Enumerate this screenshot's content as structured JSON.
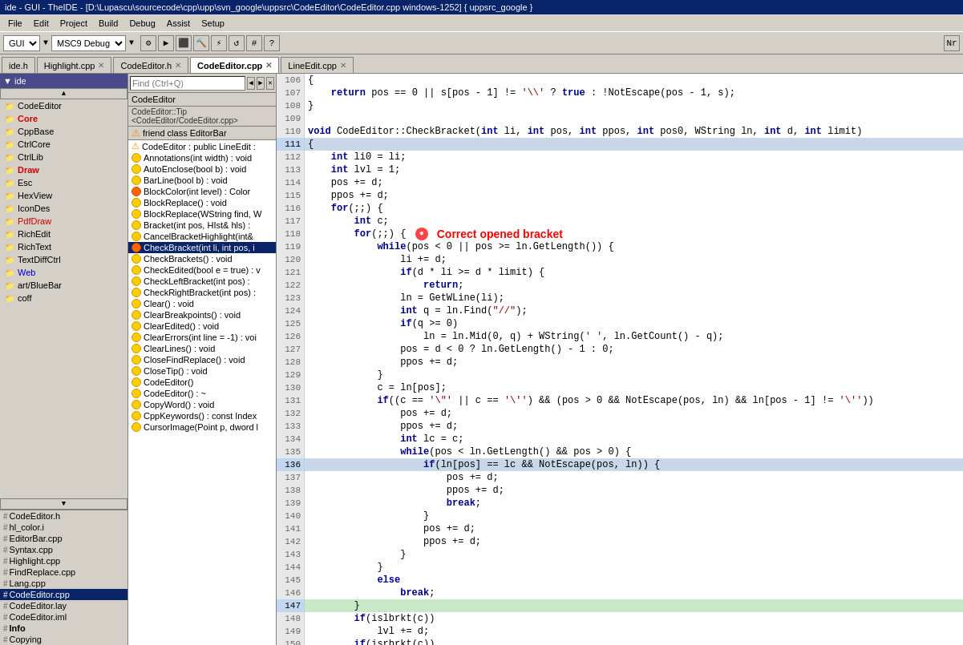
{
  "titleBar": {
    "text": "ide - GUI - TheIDE - [D:\\Lupascu\\sourcecode\\cpp\\upp\\svn_google\\uppsrc\\CodeEditor\\CodeEditor.cpp windows-1252] { uppsrc_google }"
  },
  "menuBar": {
    "items": [
      "File",
      "Edit",
      "Project",
      "Build",
      "Debug",
      "Assist",
      "Setup"
    ]
  },
  "toolbar": {
    "dropdowns": [
      "GUI",
      "MSC9 Debug"
    ]
  },
  "tabs": [
    {
      "label": "ide.h",
      "active": false,
      "closable": false
    },
    {
      "label": "Highlight.cpp",
      "active": false,
      "closable": true
    },
    {
      "label": "CodeEditor.h",
      "active": false,
      "closable": true
    },
    {
      "label": "CodeEditor.cpp",
      "active": true,
      "closable": true
    },
    {
      "label": "LineEdit.cpp",
      "active": false,
      "closable": true
    }
  ],
  "sidebar": {
    "header": "ide",
    "items": [
      {
        "label": "CodeEditor",
        "indent": 0,
        "selected": false
      },
      {
        "label": "Core",
        "indent": 0,
        "selected": false,
        "bold": true,
        "color": "#cc0000"
      },
      {
        "label": "CppBase",
        "indent": 0,
        "selected": false
      },
      {
        "label": "CtrlCore",
        "indent": 0,
        "selected": false
      },
      {
        "label": "CtrlLib",
        "indent": 0,
        "selected": false
      },
      {
        "label": "Draw",
        "indent": 0,
        "selected": false,
        "bold": true,
        "color": "#cc0000"
      },
      {
        "label": "Esc",
        "indent": 0,
        "selected": false
      },
      {
        "label": "HexView",
        "indent": 0,
        "selected": false
      },
      {
        "label": "IconDes",
        "indent": 0,
        "selected": false
      },
      {
        "label": "PdfDraw",
        "indent": 0,
        "selected": false,
        "color": "#cc0000"
      },
      {
        "label": "RichEdit",
        "indent": 0,
        "selected": false
      },
      {
        "label": "RichText",
        "indent": 0,
        "selected": false
      },
      {
        "label": "TextDiffCtrl",
        "indent": 0,
        "selected": false
      },
      {
        "label": "Web",
        "indent": 0,
        "selected": false,
        "color": "#0000cc"
      },
      {
        "label": "art/BlueBar",
        "indent": 0,
        "selected": false
      },
      {
        "label": "coff",
        "indent": 0,
        "selected": false
      }
    ]
  },
  "fileList": {
    "items": [
      {
        "label": "CodeEditor.h",
        "icon": "#"
      },
      {
        "label": "hl_color.i",
        "icon": "#"
      },
      {
        "label": "EditorBar.cpp",
        "icon": "#"
      },
      {
        "label": "Syntax.cpp",
        "icon": "#"
      },
      {
        "label": "Highlight.cpp",
        "icon": "#"
      },
      {
        "label": "FindReplace.cpp",
        "icon": "#"
      },
      {
        "label": "Lang.cpp",
        "icon": "#"
      },
      {
        "label": "CodeEditor.cpp",
        "icon": "#",
        "selected": true
      },
      {
        "label": "CodeEditor.lay",
        "icon": "#"
      },
      {
        "label": "CodeEditor.iml",
        "icon": "#"
      },
      {
        "label": "Info",
        "icon": "#"
      },
      {
        "label": "Copying",
        "icon": "#"
      }
    ]
  },
  "outline": {
    "header": "CodeEditor",
    "subheader": "CodeEditor::Tip",
    "path": "<CodeEditor/CodeEditor.cpp>",
    "listHeader": "friend class EditorBar",
    "items": [
      {
        "label": "CodeEditor : public LineEdit :",
        "type": "warning",
        "dot": null
      },
      {
        "label": "Annotations(int width) : void",
        "type": "dot",
        "dot": "yellow"
      },
      {
        "label": "AutoEnclose(bool b) : void",
        "type": "dot",
        "dot": "yellow"
      },
      {
        "label": "BarLine(bool b) : void",
        "type": "dot",
        "dot": "yellow"
      },
      {
        "label": "BlockColor(int level) : Color",
        "type": "dot",
        "dot": "orange"
      },
      {
        "label": "BlockReplace() : void",
        "type": "dot",
        "dot": "yellow"
      },
      {
        "label": "BlockReplace(WString find, W",
        "type": "dot",
        "dot": "yellow"
      },
      {
        "label": "Bracket(int pos, HIst& hls) :",
        "type": "dot",
        "dot": "yellow"
      },
      {
        "label": "CancelBracketHighlight(int&",
        "type": "dot",
        "dot": "yellow"
      },
      {
        "label": "CheckBracket(int li, int pos, i",
        "type": "dot",
        "dot": "orange",
        "selected": true
      },
      {
        "label": "CheckBrackets() : void",
        "type": "dot",
        "dot": "yellow"
      },
      {
        "label": "CheckEdited(bool e = true) : v",
        "type": "dot",
        "dot": "yellow"
      },
      {
        "label": "CheckLeftBracket(int pos) :",
        "type": "dot",
        "dot": "yellow"
      },
      {
        "label": "CheckRightBracket(int pos) :",
        "type": "dot",
        "dot": "yellow"
      },
      {
        "label": "Clear() : void",
        "type": "dot",
        "dot": "yellow"
      },
      {
        "label": "ClearBreakpoints() : void",
        "type": "dot",
        "dot": "yellow"
      },
      {
        "label": "ClearEdited() : void",
        "type": "dot",
        "dot": "yellow"
      },
      {
        "label": "ClearErrors(int line = -1) : voi",
        "type": "dot",
        "dot": "yellow"
      },
      {
        "label": "ClearLines() : void",
        "type": "dot",
        "dot": "yellow"
      },
      {
        "label": "CloseFindReplace() : void",
        "type": "dot",
        "dot": "yellow"
      },
      {
        "label": "CloseTip() : void",
        "type": "dot",
        "dot": "yellow"
      },
      {
        "label": "CodeEditor()",
        "type": "dot",
        "dot": "yellow"
      },
      {
        "label": "CodeEditor() : ~",
        "type": "dot",
        "dot": "yellow"
      },
      {
        "label": "CopyWord() : void",
        "type": "dot",
        "dot": "yellow"
      },
      {
        "label": "CppKeywords() : const Index",
        "type": "dot",
        "dot": "yellow"
      },
      {
        "label": "CursorImage(Point p, dword l",
        "type": "dot",
        "dot": "yellow"
      }
    ]
  },
  "codeLines": [
    {
      "num": 106,
      "content": "{",
      "highlight": false
    },
    {
      "num": 107,
      "content": "    return pos == 0 || s[pos - 1] != '\\\\' ? true : !NotEscape(pos - 1, s);",
      "highlight": false
    },
    {
      "num": 108,
      "content": "}",
      "highlight": false
    },
    {
      "num": 109,
      "content": "",
      "highlight": false
    },
    {
      "num": 110,
      "content": "void CodeEditor::CheckBracket(int li, int pos, int ppos, int pos0, WString ln, int d, int limit)",
      "highlight": false
    },
    {
      "num": 111,
      "content": "{",
      "highlight": true
    },
    {
      "num": 112,
      "content": "    int li0 = li;",
      "highlight": false
    },
    {
      "num": 113,
      "content": "    int lvl = 1;",
      "highlight": false
    },
    {
      "num": 114,
      "content": "    pos += d;",
      "highlight": false
    },
    {
      "num": 115,
      "content": "    ppos += d;",
      "highlight": false
    },
    {
      "num": 116,
      "content": "    for(;;) {",
      "highlight": false
    },
    {
      "num": 117,
      "content": "        int c;",
      "highlight": false
    },
    {
      "num": 118,
      "content": "        for(;;) {",
      "highlight": false,
      "annotation": true
    },
    {
      "num": 119,
      "content": "            while(pos < 0 || pos >= ln.GetLength()) {",
      "highlight": false
    },
    {
      "num": 120,
      "content": "                li += d;",
      "highlight": false
    },
    {
      "num": 121,
      "content": "                if(d * li >= d * limit) {",
      "highlight": false
    },
    {
      "num": 122,
      "content": "                    return;",
      "highlight": false
    },
    {
      "num": 123,
      "content": "                ln = GetWLine(li);",
      "highlight": false
    },
    {
      "num": 124,
      "content": "                int q = ln.Find(\"//\");",
      "highlight": false
    },
    {
      "num": 125,
      "content": "                if(q >= 0)",
      "highlight": false
    },
    {
      "num": 126,
      "content": "                    ln = ln.Mid(0, q) + WString(' ', ln.GetCount() - q);",
      "highlight": false
    },
    {
      "num": 127,
      "content": "                pos = d < 0 ? ln.GetLength() - 1 : 0;",
      "highlight": false
    },
    {
      "num": 128,
      "content": "                ppos += d;",
      "highlight": false
    },
    {
      "num": 129,
      "content": "            }",
      "highlight": false
    },
    {
      "num": 130,
      "content": "            c = ln[pos];",
      "highlight": false
    },
    {
      "num": 131,
      "content": "            if((c == '\\\"' || c == '\\'') && (pos > 0 && NotEscape(pos, ln) && ln[pos - 1] != '\\'')",
      "highlight": false
    },
    {
      "num": 132,
      "content": "                pos += d;",
      "highlight": false
    },
    {
      "num": 133,
      "content": "                ppos += d;",
      "highlight": false
    },
    {
      "num": 134,
      "content": "                int lc = c;",
      "highlight": false
    },
    {
      "num": 135,
      "content": "                while(pos < ln.GetLength() && pos > 0) {",
      "highlight": false
    },
    {
      "num": 136,
      "content": "                    if(ln[pos] == lc && NotEscape(pos, ln)) {",
      "highlight": true
    },
    {
      "num": 137,
      "content": "                        pos += d;",
      "highlight": false
    },
    {
      "num": 138,
      "content": "                        ppos += d;",
      "highlight": false
    },
    {
      "num": 139,
      "content": "                        break;",
      "highlight": false
    },
    {
      "num": 140,
      "content": "                    }",
      "highlight": false
    },
    {
      "num": 141,
      "content": "                    pos += d;",
      "highlight": false
    },
    {
      "num": 142,
      "content": "                    ppos += d;",
      "highlight": false
    },
    {
      "num": 143,
      "content": "                }",
      "highlight": false
    },
    {
      "num": 144,
      "content": "            }",
      "highlight": false
    },
    {
      "num": 145,
      "content": "            else",
      "highlight": false
    },
    {
      "num": 146,
      "content": "                break;",
      "highlight": false
    },
    {
      "num": 147,
      "content": "        }",
      "highlight": true,
      "current": true
    },
    {
      "num": 148,
      "content": "        if(islbrkt(c))",
      "highlight": false
    },
    {
      "num": 149,
      "content": "            lvl += d;",
      "highlight": false
    },
    {
      "num": 150,
      "content": "        if(isrbrkt(c))",
      "highlight": false
    }
  ],
  "annotation": {
    "bubbleText": "●",
    "text": "Correct opened bracket"
  }
}
